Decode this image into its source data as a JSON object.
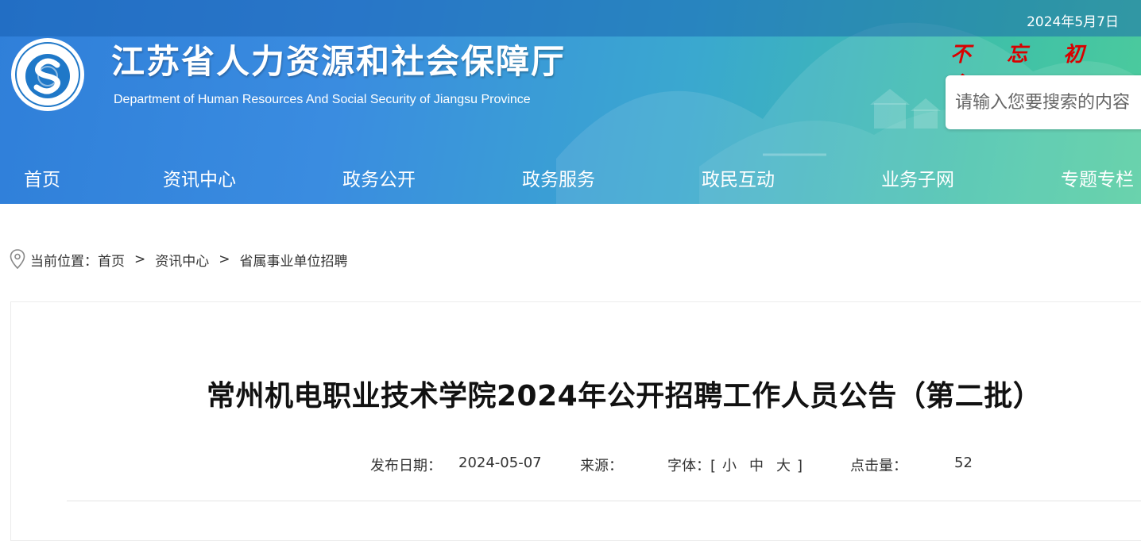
{
  "header": {
    "date": "2024年5月7日",
    "title": "江苏省人力资源和社会保障厅",
    "subtitle": "Department of Human Resources And Social Security of Jiangsu Province",
    "slogan": "不 忘 初 心",
    "emblem_ring_text": "江苏省人力资源和社会保障厅"
  },
  "search": {
    "placeholder": "请输入您要搜索的内容"
  },
  "nav": {
    "items": [
      {
        "label": "首页"
      },
      {
        "label": "资讯中心"
      },
      {
        "label": "政务公开"
      },
      {
        "label": "政务服务"
      },
      {
        "label": "政民互动"
      },
      {
        "label": "业务子网"
      },
      {
        "label": "专题专栏"
      }
    ]
  },
  "breadcrumb": {
    "prefix": "当前位置：",
    "items": [
      "首页",
      "资讯中心",
      "省属事业单位招聘"
    ],
    "separator": ">"
  },
  "article": {
    "title": "常州机电职业技术学院2024年公开招聘工作人员公告（第二批）",
    "publish_label": "发布日期：",
    "publish_date": "2024-05-07",
    "source_label": "来源：",
    "source_value": "",
    "font_label": "字体：",
    "font_open": "[",
    "font_small": "小",
    "font_medium": "中",
    "font_large": "大",
    "font_close": "]",
    "views_label": "点击量：",
    "views_value": "52"
  },
  "colors": {
    "header_start": "#2f7fd9",
    "header_end": "#4ccb9c",
    "slogan": "#d90000"
  },
  "icons": [
    "emblem-logo",
    "location-pin-icon"
  ]
}
